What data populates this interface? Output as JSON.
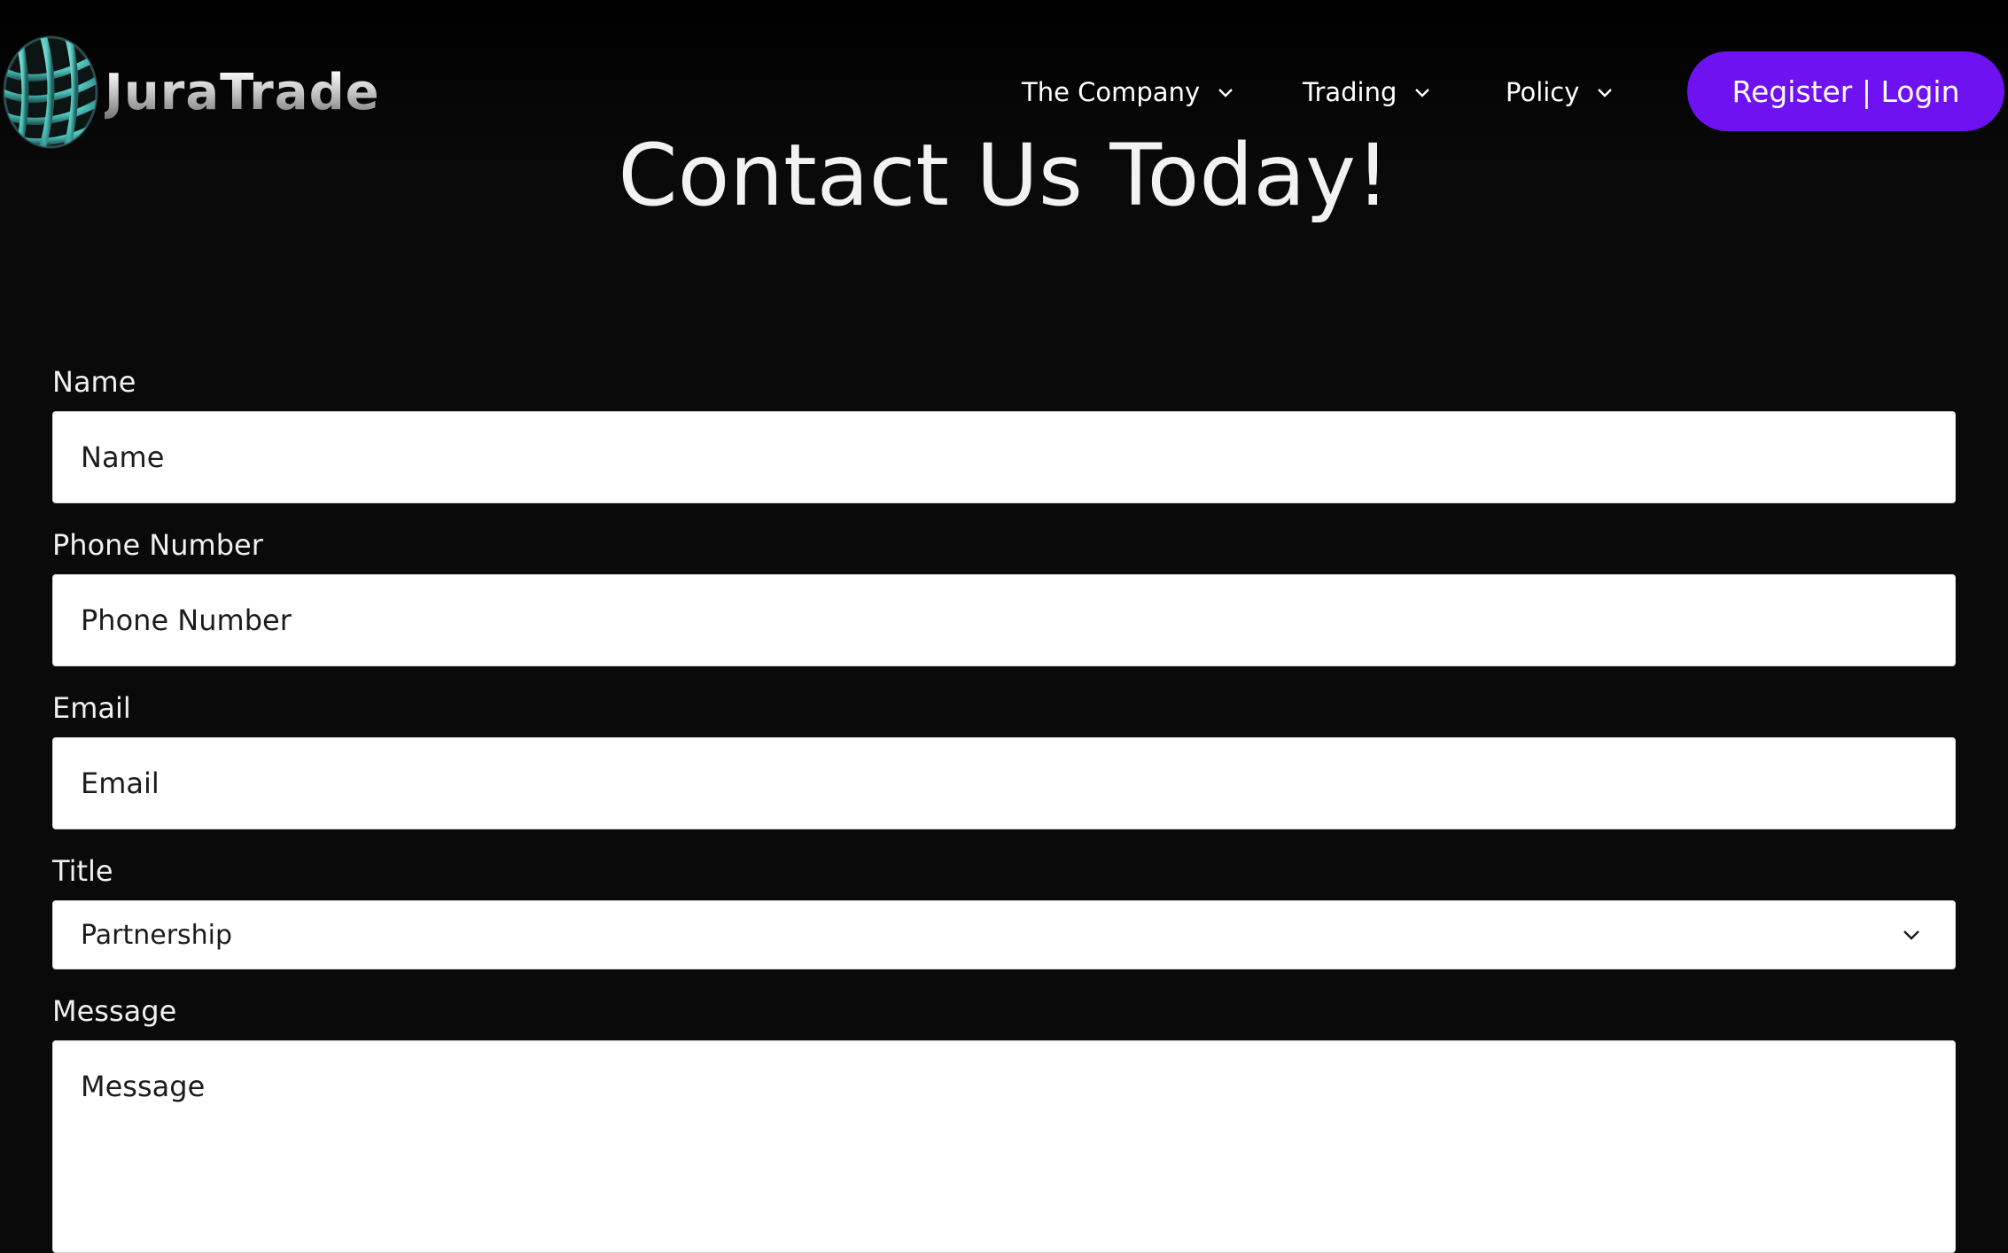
{
  "header": {
    "logo_text": "JuraTrade",
    "nav": [
      {
        "label": "The Company",
        "icon": "chevron-down-icon"
      },
      {
        "label": "Trading",
        "icon": "chevron-down-icon"
      },
      {
        "label": "Policy",
        "icon": "chevron-down-icon"
      }
    ],
    "cta_label": "Register | Login"
  },
  "page": {
    "title": "Contact Us Today!"
  },
  "form": {
    "name": {
      "label": "Name",
      "placeholder": "Name"
    },
    "phone": {
      "label": "Phone Number",
      "placeholder": "Phone Number"
    },
    "email": {
      "label": "Email",
      "placeholder": "Email"
    },
    "title": {
      "label": "Title",
      "value": "Partnership",
      "icon": "chevron-down-icon"
    },
    "message": {
      "label": "Message",
      "placeholder": "Message"
    }
  },
  "colors": {
    "background": "#0a0a0b",
    "accent": "#6f12f2",
    "logo_teal": "#5fd8d0"
  }
}
